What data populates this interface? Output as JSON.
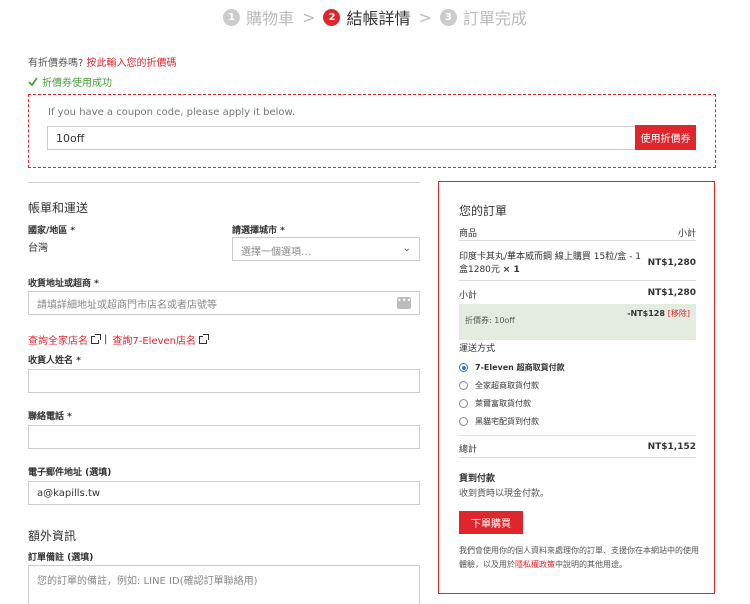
{
  "steps": [
    {
      "num": "1",
      "label": "購物車"
    },
    {
      "num": "2",
      "label": "結帳詳情"
    },
    {
      "num": "3",
      "label": "訂單完成"
    }
  ],
  "step_separator": ">",
  "coupon": {
    "question": "有折價券嗎?",
    "link": "按此輸入您的折價碼",
    "success": "折價券使用成功",
    "hint": "If you have a coupon code, please apply it below.",
    "value": "10off",
    "apply_label": "使用折價券"
  },
  "form": {
    "billing_title": "帳單和運送",
    "country_label": "國家/地區 *",
    "country_value": "台灣",
    "city_label": "請選擇城市 *",
    "city_placeholder": "選擇一個選項…",
    "address_label": "收貨地址或超商 *",
    "address_placeholder": "請填詳細地址或超商門市店名或者店號等",
    "store_link_family": "查詢全家店名",
    "store_link_sep": "|",
    "store_link_seven": "查詢7-Eleven店名",
    "name_label": "收貨人姓名 *",
    "name_value": "",
    "phone_label": "聯絡電話 *",
    "phone_value": "",
    "email_label": "電子郵件地址 (選填)",
    "email_value": "a@kapills.tw",
    "extra_title": "額外資訊",
    "notes_label": "訂單備註 (選填)",
    "notes_placeholder": "您的訂單的備註，例如: LINE ID(確認訂單聯絡用)"
  },
  "order": {
    "title": "您的訂單",
    "col_product": "商品",
    "col_subtotal": "小計",
    "item_name_line1": "印度卡其丸/華本威而鋼 線上購買 15粒/盒 - 1",
    "item_name_line2": "盒1280元",
    "item_qty": "× 1",
    "item_price": "NT$1,280",
    "subtotal_label": "小計",
    "subtotal_value": "NT$1,280",
    "discount_label": "折價券: 10off",
    "discount_value": "-NT$128",
    "discount_remove": "[移除]",
    "shipping_label": "運送方式",
    "shipping_options": [
      {
        "label": "7-Eleven 超商取貨付款",
        "selected": true
      },
      {
        "label": "全家超商取貨付款",
        "selected": false
      },
      {
        "label": "萊爾富取貨付款",
        "selected": false
      },
      {
        "label": "黑貓宅配貨到付款",
        "selected": false
      }
    ],
    "total_label": "總計",
    "total_value": "NT$1,152",
    "payment_title": "貨到付款",
    "payment_desc": "收到貨時以現金付款。",
    "submit_label": "下單購買",
    "privacy_pre": "我們會使用你的個人資料來處理你的訂單、支援你在本網站中的使用體驗，以及用於",
    "privacy_link": "隱私權政策",
    "privacy_post": "中說明的其他用途。"
  },
  "colors": {
    "accent": "#e0262d",
    "success": "#4a9d3a",
    "discount_bg": "#e4ecdf",
    "radio": "#2b7bd6"
  }
}
